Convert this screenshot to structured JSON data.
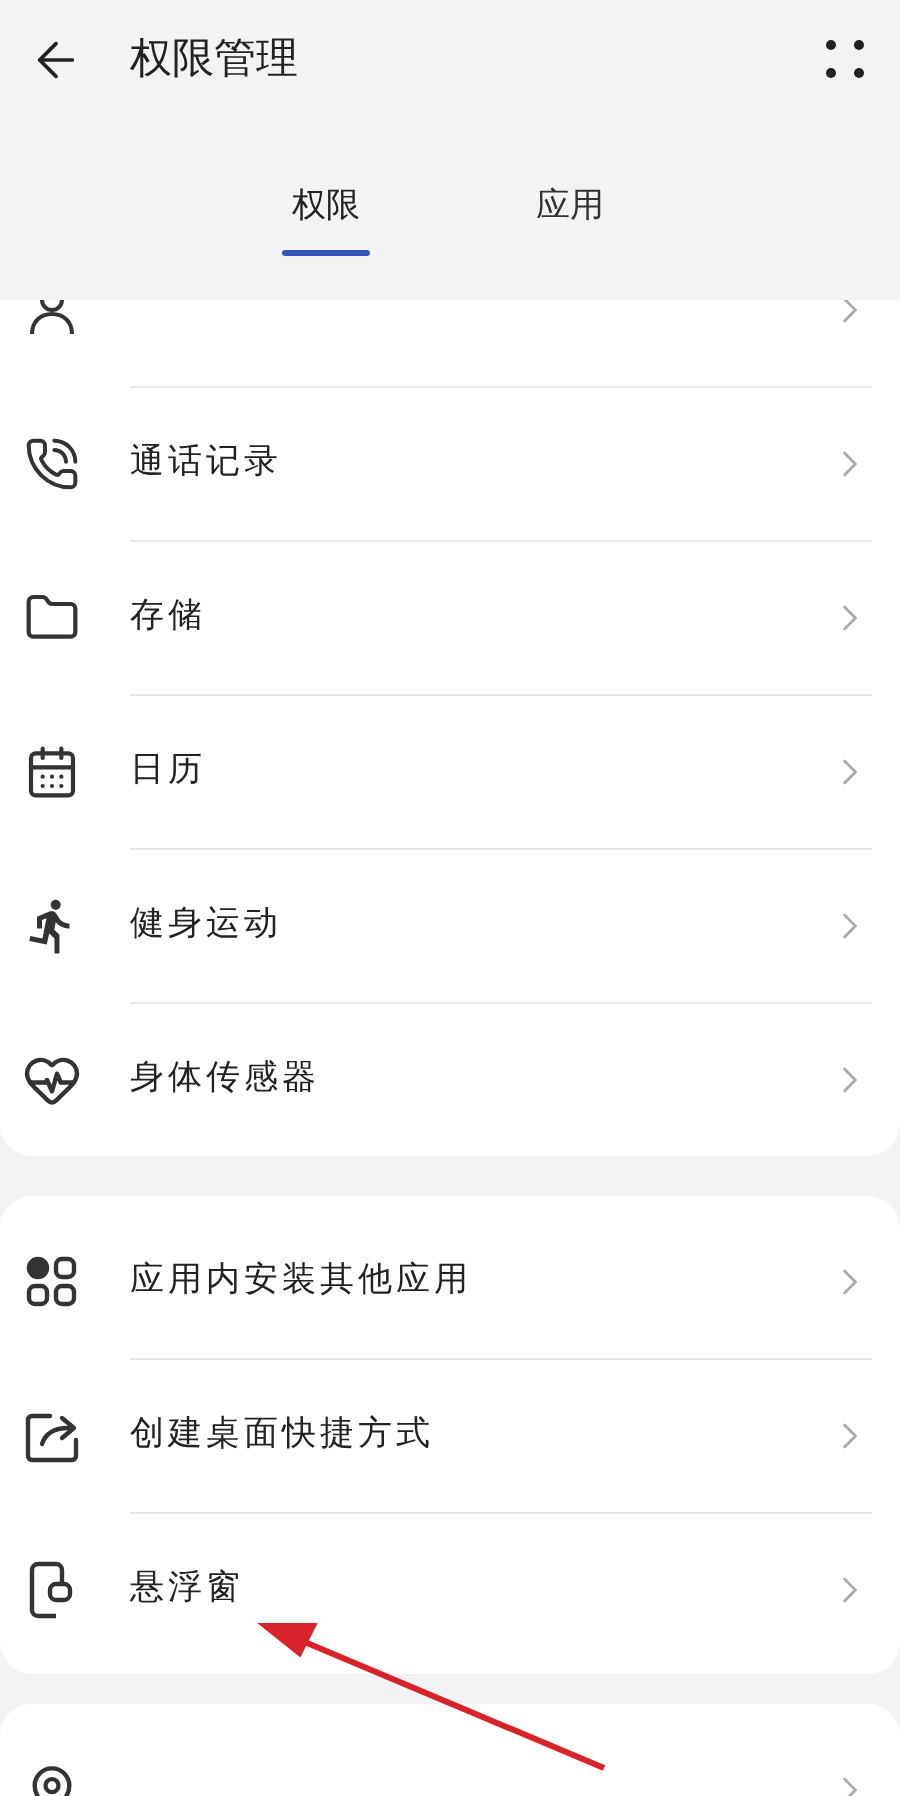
{
  "header": {
    "title": "权限管理"
  },
  "tabs": [
    {
      "label": "权限",
      "selected": true
    },
    {
      "label": "应用",
      "selected": false
    }
  ],
  "sections": [
    {
      "items": [
        {
          "kind": "cut"
        },
        {
          "kind": "row",
          "label": "通话记录"
        },
        {
          "kind": "row",
          "label": "存储"
        },
        {
          "kind": "row",
          "label": "日历"
        },
        {
          "kind": "row",
          "label": "健身运动"
        },
        {
          "kind": "row",
          "label": "身体传感器"
        }
      ]
    },
    {
      "items": [
        {
          "kind": "row",
          "label": "应用内安装其他应用"
        },
        {
          "kind": "row",
          "label": "创建桌面快捷方式"
        },
        {
          "kind": "row",
          "label": "悬浮窗"
        }
      ]
    },
    {
      "items": [
        {
          "kind": "cut"
        }
      ]
    }
  ]
}
